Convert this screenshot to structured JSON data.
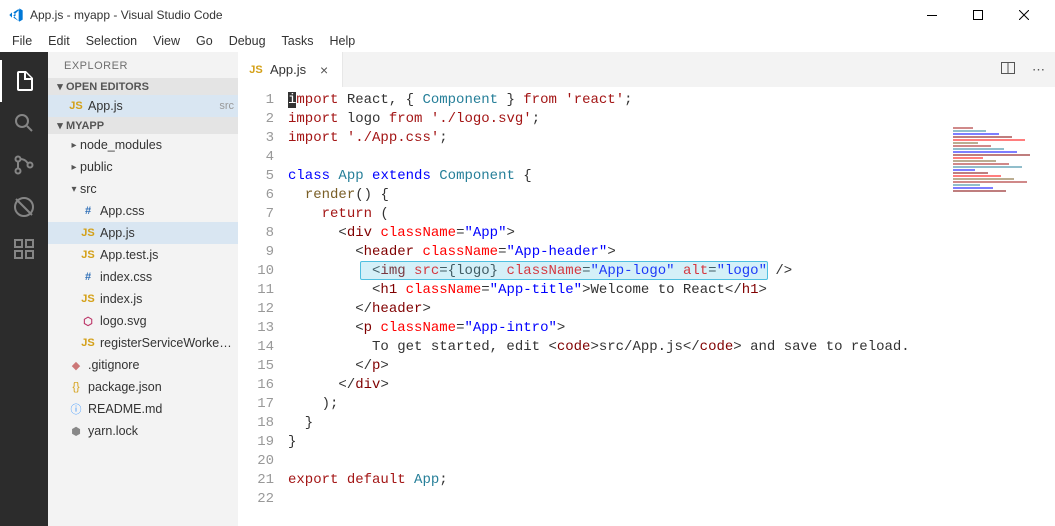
{
  "window": {
    "title": "App.js - myapp - Visual Studio Code"
  },
  "menu": [
    "File",
    "Edit",
    "Selection",
    "View",
    "Go",
    "Debug",
    "Tasks",
    "Help"
  ],
  "sidebar": {
    "title": "EXPLORER",
    "open_editors_header": "OPEN EDITORS",
    "open_editors": [
      {
        "icon": "JS",
        "iconClass": "ic-js",
        "label": "App.js",
        "desc": "src"
      }
    ],
    "project_header": "MYAPP",
    "tree": [
      {
        "type": "folder",
        "open": false,
        "label": "node_modules",
        "indent": 1
      },
      {
        "type": "folder",
        "open": false,
        "label": "public",
        "indent": 1
      },
      {
        "type": "folder",
        "open": true,
        "label": "src",
        "indent": 1
      },
      {
        "type": "file",
        "icon": "#",
        "iconClass": "ic-css",
        "label": "App.css",
        "indent": 2
      },
      {
        "type": "file",
        "icon": "JS",
        "iconClass": "ic-js",
        "label": "App.js",
        "indent": 2,
        "selected": true
      },
      {
        "type": "file",
        "icon": "JS",
        "iconClass": "ic-js",
        "label": "App.test.js",
        "indent": 2
      },
      {
        "type": "file",
        "icon": "#",
        "iconClass": "ic-css",
        "label": "index.css",
        "indent": 2
      },
      {
        "type": "file",
        "icon": "JS",
        "iconClass": "ic-js",
        "label": "index.js",
        "indent": 2
      },
      {
        "type": "file",
        "icon": "⬡",
        "iconClass": "ic-svg",
        "label": "logo.svg",
        "indent": 2
      },
      {
        "type": "file",
        "icon": "JS",
        "iconClass": "ic-js",
        "label": "registerServiceWorker.js",
        "indent": 2
      },
      {
        "type": "file",
        "icon": "◆",
        "iconClass": "ic-git",
        "label": ".gitignore",
        "indent": 1
      },
      {
        "type": "file",
        "icon": "{}",
        "iconClass": "ic-json",
        "label": "package.json",
        "indent": 1
      },
      {
        "type": "file",
        "icon": "ⓘ",
        "iconClass": "ic-info",
        "label": "README.md",
        "indent": 1
      },
      {
        "type": "file",
        "icon": "⬢",
        "iconClass": "ic-lock",
        "label": "yarn.lock",
        "indent": 1
      }
    ]
  },
  "tabs": [
    {
      "icon": "JS",
      "iconClass": "ic-js",
      "label": "App.js"
    }
  ],
  "editor": {
    "highlight_line": 10,
    "lines": 22,
    "code": [
      [
        [
          "cursor",
          "i"
        ],
        [
          "kw",
          "mport"
        ],
        [
          "",
          " React, { "
        ],
        [
          "cls",
          "Component"
        ],
        [
          "",
          " } "
        ],
        [
          "kw",
          "from"
        ],
        [
          "",
          " "
        ],
        [
          "str",
          "'react'"
        ],
        [
          "",
          ";"
        ]
      ],
      [
        [
          "kw",
          "import"
        ],
        [
          "",
          " logo "
        ],
        [
          "kw",
          "from"
        ],
        [
          "",
          " "
        ],
        [
          "str",
          "'./logo.svg'"
        ],
        [
          "",
          ";"
        ]
      ],
      [
        [
          "kw",
          "import"
        ],
        [
          "",
          " "
        ],
        [
          "str",
          "'./App.css'"
        ],
        [
          "",
          ";"
        ]
      ],
      [],
      [
        [
          "kw2",
          "class"
        ],
        [
          "",
          " "
        ],
        [
          "cls",
          "App"
        ],
        [
          "",
          " "
        ],
        [
          "kw2",
          "extends"
        ],
        [
          "",
          " "
        ],
        [
          "cls",
          "Component"
        ],
        [
          "",
          " {"
        ]
      ],
      [
        [
          "",
          "  "
        ],
        [
          "fn",
          "render"
        ],
        [
          "",
          "() {"
        ]
      ],
      [
        [
          "",
          "    "
        ],
        [
          "kw",
          "return"
        ],
        [
          "",
          " ("
        ]
      ],
      [
        [
          "",
          "      <"
        ],
        [
          "tag",
          "div"
        ],
        [
          "",
          " "
        ],
        [
          "attr",
          "className"
        ],
        [
          "",
          "="
        ],
        [
          "val",
          "\"App\""
        ],
        [
          "",
          ">"
        ]
      ],
      [
        [
          "",
          "        <"
        ],
        [
          "tag",
          "header"
        ],
        [
          "",
          " "
        ],
        [
          "attr",
          "className"
        ],
        [
          "",
          "="
        ],
        [
          "val",
          "\"App-header\""
        ],
        [
          "",
          ">"
        ]
      ],
      [
        [
          "",
          "          <"
        ],
        [
          "tag",
          "img"
        ],
        [
          "",
          " "
        ],
        [
          "attr",
          "src"
        ],
        [
          "",
          "={logo} "
        ],
        [
          "attr",
          "className"
        ],
        [
          "",
          "="
        ],
        [
          "val",
          "\"App-logo\""
        ],
        [
          "",
          " "
        ],
        [
          "attr",
          "alt"
        ],
        [
          "",
          "="
        ],
        [
          "val",
          "\"logo\""
        ],
        [
          "",
          " />"
        ]
      ],
      [
        [
          "",
          "          <"
        ],
        [
          "tag",
          "h1"
        ],
        [
          "",
          " "
        ],
        [
          "attr",
          "className"
        ],
        [
          "",
          "="
        ],
        [
          "val",
          "\"App-title\""
        ],
        [
          "",
          ">Welcome to React</"
        ],
        [
          "tag",
          "h1"
        ],
        [
          "",
          ">"
        ]
      ],
      [
        [
          "",
          "        </"
        ],
        [
          "tag",
          "header"
        ],
        [
          "",
          ">"
        ]
      ],
      [
        [
          "",
          "        <"
        ],
        [
          "tag",
          "p"
        ],
        [
          "",
          " "
        ],
        [
          "attr",
          "className"
        ],
        [
          "",
          "="
        ],
        [
          "val",
          "\"App-intro\""
        ],
        [
          "",
          ">"
        ]
      ],
      [
        [
          "",
          "          To get started, edit <"
        ],
        [
          "tag",
          "code"
        ],
        [
          "",
          ">src/App.js</"
        ],
        [
          "tag",
          "code"
        ],
        [
          "",
          "> and save to reload."
        ]
      ],
      [
        [
          "",
          "        </"
        ],
        [
          "tag",
          "p"
        ],
        [
          "",
          ">"
        ]
      ],
      [
        [
          "",
          "      </"
        ],
        [
          "tag",
          "div"
        ],
        [
          "",
          ">"
        ]
      ],
      [
        [
          "",
          "    );"
        ]
      ],
      [
        [
          "",
          "  }"
        ]
      ],
      [
        [
          "",
          "}"
        ]
      ],
      [],
      [
        [
          "kw",
          "export"
        ],
        [
          "",
          " "
        ],
        [
          "kw",
          "default"
        ],
        [
          "",
          " "
        ],
        [
          "cls",
          "App"
        ],
        [
          "",
          ";"
        ]
      ],
      []
    ]
  }
}
